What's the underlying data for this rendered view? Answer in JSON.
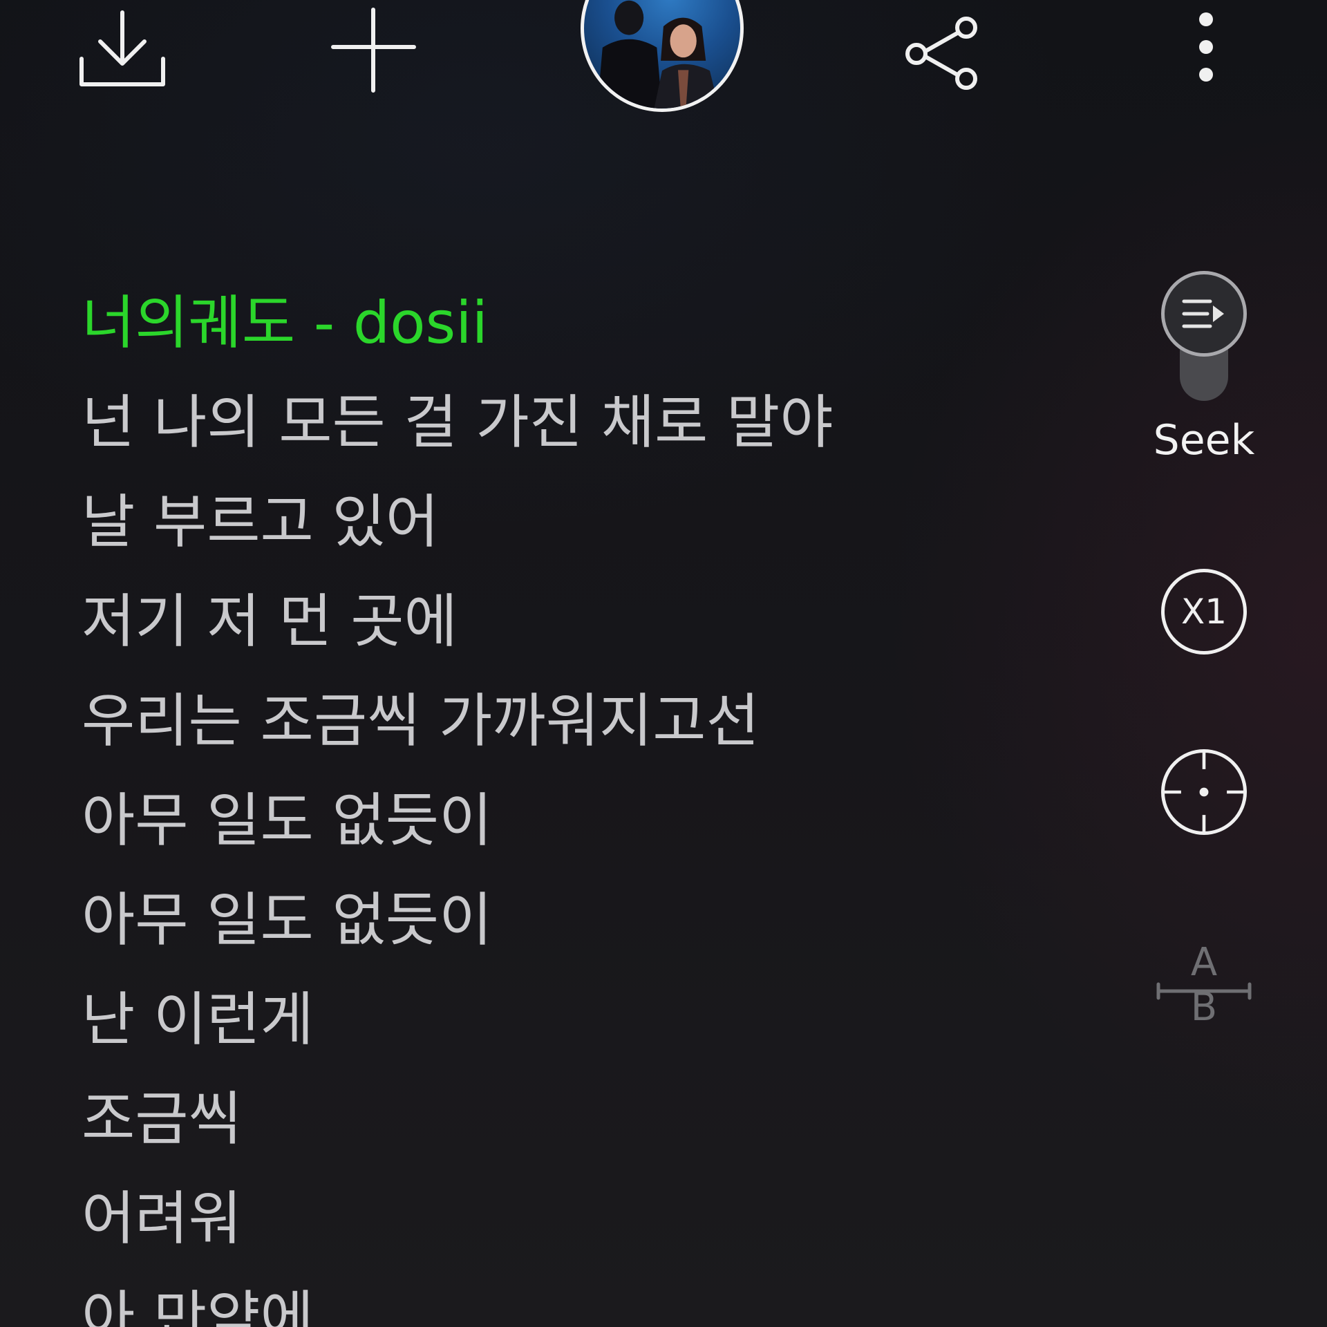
{
  "toolbar": {
    "download_icon": "download-icon",
    "add_icon": "plus-icon",
    "share_icon": "share-icon",
    "more_icon": "more-vertical-icon"
  },
  "lyrics": {
    "lines": [
      "너의궤도 - dosii",
      "넌 나의 모든 걸 가진 채로 말야",
      "날 부르고 있어",
      "저기 저 먼 곳에",
      "우리는 조금씩 가까워지고선",
      "아무 일도 없듯이",
      "아무 일도 없듯이",
      "난 이런게",
      "조금씩",
      "어려워",
      "아 만약에"
    ],
    "active_color": "#2bd62b",
    "line_color": "#c9c9cc"
  },
  "controls": {
    "seek_label": "Seek",
    "speed_label": "X1",
    "ab_label": "A B",
    "seek_icon": "seek-icon",
    "target_icon": "crosshair-icon",
    "ab_icon": "ab-repeat-icon"
  }
}
